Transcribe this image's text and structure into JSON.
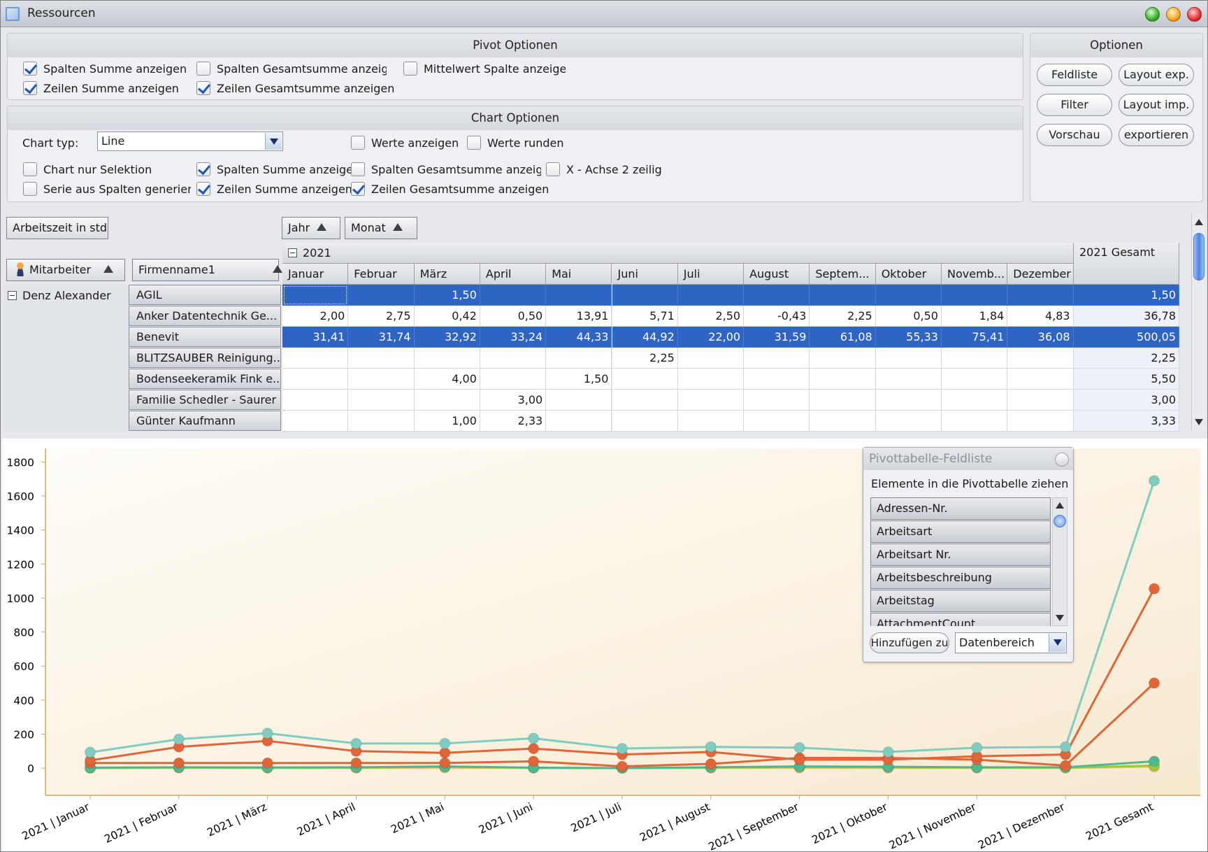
{
  "window": {
    "title": "Ressourcen"
  },
  "pivot_options": {
    "title": "Pivot Optionen",
    "items": [
      {
        "label": "Spalten Summe anzeigen",
        "checked": true
      },
      {
        "label": "Spalten Gesamtsumme anzeige",
        "checked": false
      },
      {
        "label": "Mittelwert Spalte anzeige",
        "checked": false
      },
      {
        "label": "Zeilen Summe anzeigen",
        "checked": true
      },
      {
        "label": "Zeilen Gesamtsumme anzeigen",
        "checked": true
      }
    ]
  },
  "chart_options": {
    "title": "Chart Optionen",
    "chart_type_label": "Chart typ:",
    "chart_type_value": "Line",
    "items": [
      {
        "label": "Werte anzeigen",
        "checked": false
      },
      {
        "label": "Werte runden",
        "checked": false
      },
      {
        "label": "Chart nur Selektion",
        "checked": false
      },
      {
        "label": "Spalten Summe anzeigen",
        "checked": true
      },
      {
        "label": "Spalten Gesamtsumme anzeige",
        "checked": false
      },
      {
        "label": "X - Achse 2 zeilig",
        "checked": false
      },
      {
        "label": "Serie aus Spalten generieren",
        "checked": false
      },
      {
        "label": "Zeilen Summe anzeigen",
        "checked": true
      },
      {
        "label": "Zeilen Gesamtsumme anzeigen",
        "checked": true
      }
    ]
  },
  "options": {
    "title": "Optionen",
    "buttons": [
      "Feldliste",
      "Layout exp.",
      "Filter",
      "Layout imp.",
      "Vorschau",
      "exportieren"
    ]
  },
  "pivot": {
    "data_field": "Arbeitszeit in std",
    "column_fields": [
      "Jahr",
      "Monat"
    ],
    "row_fields": [
      "Mitarbeiter",
      "Firmenname1"
    ],
    "year": "2021",
    "year_total": "2021 Gesamt",
    "months": [
      "Januar",
      "Februar",
      "März",
      "April",
      "Mai",
      "Juni",
      "Juli",
      "August",
      "Septem...",
      "Oktober",
      "Novemb...",
      "Dezember"
    ],
    "employee": "Denz Alexander",
    "rows": [
      {
        "name": "AGIL",
        "selected": true,
        "values": [
          "",
          "",
          "1,50",
          "",
          "",
          "",
          "",
          "",
          "",
          "",
          "",
          ""
        ],
        "total": "1,50"
      },
      {
        "name": "Anker Datentechnik  Ge...",
        "selected": false,
        "values": [
          "2,00",
          "2,75",
          "0,42",
          "0,50",
          "13,91",
          "5,71",
          "2,50",
          "-0,43",
          "2,25",
          "0,50",
          "1,84",
          "4,83"
        ],
        "total": "36,78"
      },
      {
        "name": "Benevit",
        "selected": true,
        "values": [
          "31,41",
          "31,74",
          "32,92",
          "33,24",
          "44,33",
          "44,92",
          "22,00",
          "31,59",
          "61,08",
          "55,33",
          "75,41",
          "36,08"
        ],
        "total": "500,05"
      },
      {
        "name": "BLITZSAUBER Reinigung...",
        "selected": false,
        "values": [
          "",
          "",
          "",
          "",
          "",
          "2,25",
          "",
          "",
          "",
          "",
          "",
          ""
        ],
        "total": "2,25"
      },
      {
        "name": "Bodenseekeramik Fink e...",
        "selected": false,
        "values": [
          "",
          "",
          "4,00",
          "",
          "1,50",
          "",
          "",
          "",
          "",
          "",
          "",
          ""
        ],
        "total": "5,50"
      },
      {
        "name": "Familie Schedler - Saurer",
        "selected": false,
        "values": [
          "",
          "",
          "",
          "3,00",
          "",
          "",
          "",
          "",
          "",
          "",
          "",
          ""
        ],
        "total": "3,00"
      },
      {
        "name": "Günter Kaufmann",
        "selected": false,
        "values": [
          "",
          "",
          "1,00",
          "2,33",
          "",
          "",
          "",
          "",
          "",
          "",
          "",
          ""
        ],
        "total": "3,33"
      }
    ]
  },
  "field_list": {
    "title": "Pivottabelle-Feldliste",
    "description": "Elemente in die Pivottabelle ziehen",
    "items": [
      "Adressen-Nr.",
      "Arbeitsart",
      "Arbeitsart Nr.",
      "Arbeitsbeschreibung",
      "Arbeitstag",
      "AttachmentCount"
    ],
    "add_button": "Hinzufügen zu",
    "target": "Datenbereich"
  },
  "chart_data": {
    "type": "line",
    "categories": [
      "2021 | Januar",
      "2021 | Februar",
      "2021 | März",
      "2021 | April",
      "2021 | Mai",
      "2021 | Juni",
      "2021 | Juli",
      "2021 | August",
      "2021 | September",
      "2021 | Oktober",
      "2021 | November",
      "2021 | Dezember",
      "2021 Gesamt"
    ],
    "ylim": [
      -160,
      1880
    ],
    "yticks": [
      "1800",
      "1600",
      "1400",
      "1200",
      "1000",
      "800",
      "600",
      "400",
      "200",
      "0"
    ],
    "ytick_values": [
      1800,
      1600,
      1400,
      1200,
      1000,
      800,
      600,
      400,
      200,
      0
    ],
    "grid": false,
    "series": [
      {
        "color": "#7fcdc1",
        "values": [
          93,
          170,
          205,
          145,
          145,
          175,
          115,
          125,
          120,
          95,
          120,
          125,
          1690
        ]
      },
      {
        "color": "#e0663a",
        "values": [
          45,
          125,
          160,
          100,
          90,
          115,
          80,
          95,
          50,
          50,
          70,
          80,
          1055
        ]
      },
      {
        "color": "#e0663a",
        "values": [
          30,
          30,
          30,
          30,
          30,
          40,
          10,
          25,
          60,
          60,
          50,
          15,
          500
        ]
      },
      {
        "color": "#4fb88e",
        "values": [
          3,
          5,
          4,
          5,
          10,
          3,
          0,
          5,
          10,
          8,
          5,
          5,
          40
        ]
      },
      {
        "color": "#9aca3c",
        "values": [
          0,
          3,
          2,
          3,
          8,
          1,
          0,
          3,
          6,
          5,
          3,
          2,
          15
        ]
      },
      {
        "color": "#f0c46a",
        "values": [
          1,
          2,
          1,
          1,
          2,
          2,
          1,
          2,
          2,
          1,
          2,
          2,
          8
        ]
      }
    ]
  }
}
